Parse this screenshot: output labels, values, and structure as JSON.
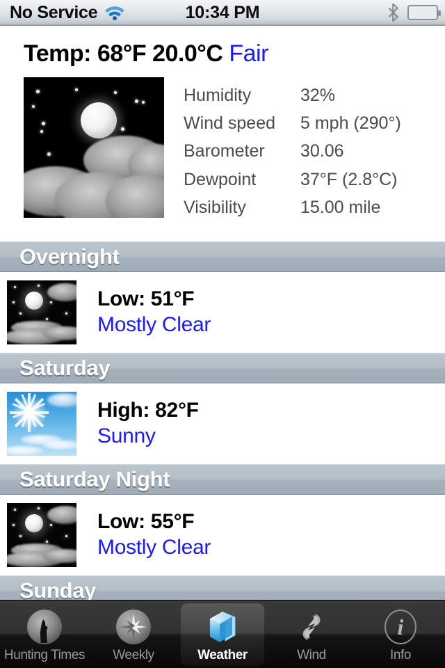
{
  "status_bar": {
    "carrier": "No Service",
    "time": "10:34 PM",
    "wifi_icon": "wifi-icon",
    "bluetooth_icon": "bluetooth-icon",
    "battery_icon": "battery-full-icon"
  },
  "current": {
    "temp_label": "Temp:",
    "temp_f": "68°F",
    "temp_c": "20.0°C",
    "temp_line": "Temp: 68°F 20.0°C",
    "condition": "Fair",
    "condition_color": "#1a1aff",
    "image_icon": "night-clear-clouds-icon",
    "details": [
      {
        "label": "Humidity",
        "value": "32%"
      },
      {
        "label": "Wind speed",
        "value": "5 mph (290°)"
      },
      {
        "label": "Barometer",
        "value": "30.06"
      },
      {
        "label": "Dewpoint",
        "value": "37°F (2.8°C)"
      },
      {
        "label": "Visibility",
        "value": "15.00 mile"
      }
    ]
  },
  "forecast": [
    {
      "header": "Overnight",
      "temp": "Low: 51°F",
      "condition": "Mostly Clear",
      "icon": "night-mostly-clear-icon"
    },
    {
      "header": "Saturday",
      "temp": "High: 82°F",
      "condition": "Sunny",
      "icon": "sunny-icon"
    },
    {
      "header": "Saturday Night",
      "temp": "Low: 55°F",
      "condition": "Mostly Clear",
      "icon": "night-mostly-clear-icon"
    },
    {
      "header": "Sunday",
      "temp": "",
      "condition": "",
      "icon": ""
    }
  ],
  "tabs": [
    {
      "label": "Hunting Times",
      "icon": "moon-howl-icon",
      "active": false
    },
    {
      "label": "Weekly",
      "icon": "compass-icon",
      "active": false
    },
    {
      "label": "Weather",
      "icon": "blue-cube-icon",
      "active": true
    },
    {
      "label": "Wind",
      "icon": "swirl-arrows-icon",
      "active": false
    },
    {
      "label": "Info",
      "icon": "info-icon",
      "active": false
    }
  ]
}
